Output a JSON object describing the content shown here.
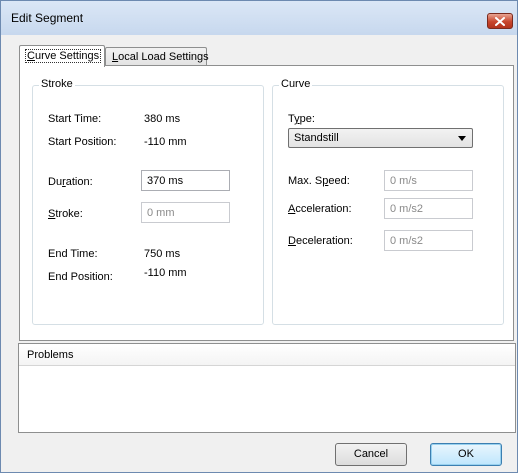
{
  "window": {
    "title": "Edit Segment"
  },
  "icons": {
    "close": "close-x-icon",
    "dropdown": "chevron-down-icon"
  },
  "tabs": [
    {
      "label_prefix": "",
      "mnemonic": "C",
      "label_rest": "urve Settings",
      "active": true
    },
    {
      "label_prefix": "",
      "mnemonic": "L",
      "label_rest": "ocal Load Settings",
      "active": false
    }
  ],
  "stroke": {
    "title": "Stroke",
    "start_time_label": "Start Time:",
    "start_time_value": "380 ms",
    "start_position_label": "Start Position:",
    "start_position_value": "-110 mm",
    "duration_prefix": "Du",
    "duration_mnemonic": "r",
    "duration_rest": "ation:",
    "duration_value": "370 ms",
    "stroke_mnemonic": "S",
    "stroke_rest": "troke:",
    "stroke_value": "0 mm",
    "end_time_label": "End Time:",
    "end_time_value": "750 ms",
    "end_position_label": "End Position:",
    "end_position_value": "-110 mm"
  },
  "curve": {
    "title": "Curve",
    "type_prefix": "T",
    "type_mnemonic": "y",
    "type_rest": "pe:",
    "type_value": "Standstill",
    "max_speed_prefix": "Max. S",
    "max_speed_mnemonic": "p",
    "max_speed_rest": "eed:",
    "max_speed_value": "0 m/s",
    "acceleration_mnemonic": "A",
    "acceleration_rest": "cceleration:",
    "acceleration_value": "0 m/s2",
    "deceleration_mnemonic": "D",
    "deceleration_rest": "eceleration:",
    "deceleration_value": "0 m/s2"
  },
  "problems": {
    "header": "Problems"
  },
  "buttons": {
    "cancel": "Cancel",
    "ok": "OK"
  },
  "colors": {
    "titlebar": "#c7d8ee",
    "close": "#c8452c",
    "ok_border": "#3c7fb1"
  }
}
